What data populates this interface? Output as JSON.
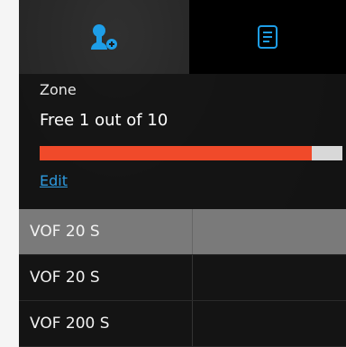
{
  "tabs": [
    {
      "icon": "user-add-icon",
      "active": false
    },
    {
      "icon": "document-icon",
      "active": true
    }
  ],
  "zone": {
    "label": "Zone",
    "quota_text": "Free 1 out of 10",
    "progress_fraction": 0.9,
    "edit_label": "Edit"
  },
  "colors": {
    "accent": "#1e9ee8",
    "progress_fill": "#f04a2a",
    "progress_track": "#d8d8d8",
    "link": "#2e9be0"
  },
  "list": {
    "items": [
      {
        "label": "VOF 20 S",
        "selected": true
      },
      {
        "label": "VOF 20 S",
        "selected": false
      },
      {
        "label": "VOF 200 S",
        "selected": false
      }
    ]
  }
}
